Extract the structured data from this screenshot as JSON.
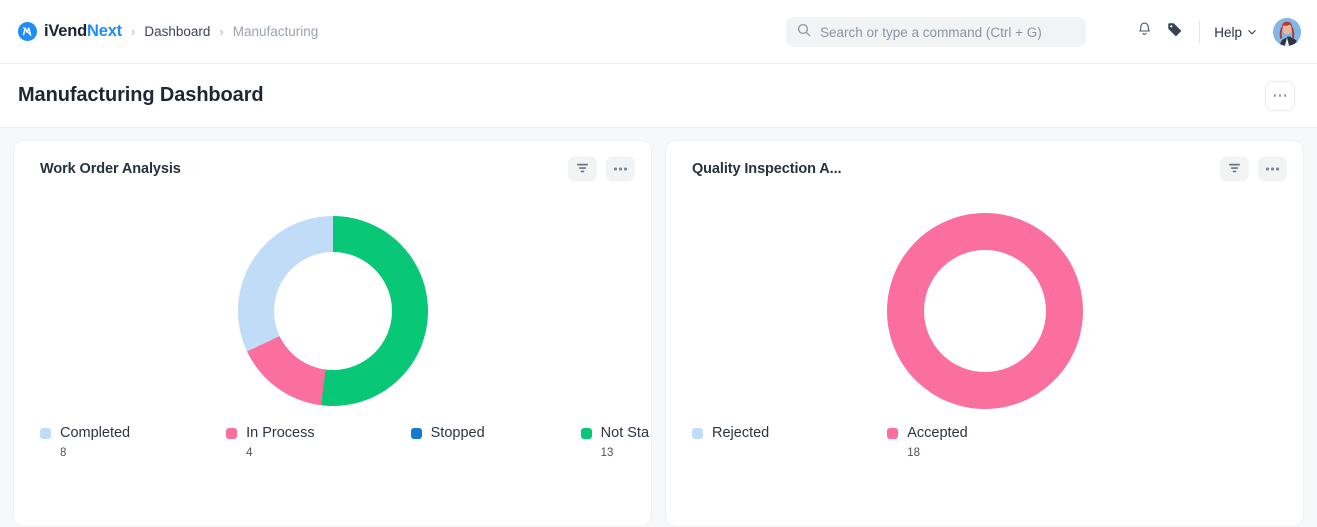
{
  "header": {
    "brand": {
      "part1": "iVend",
      "part2": "Next",
      "logo_icon": "ivendnext-logo-icon"
    },
    "breadcrumbs": [
      {
        "label": "Dashboard",
        "current": false
      },
      {
        "label": "Manufacturing",
        "current": true
      }
    ],
    "separator": "›",
    "search": {
      "placeholder": "Search or type a command (Ctrl + G)",
      "value": "",
      "icon": "search-icon"
    },
    "notifications_icon": "bell-icon",
    "tags_icon": "tag-icon",
    "help": {
      "label": "Help",
      "chevron": "chevron-down-icon"
    },
    "avatar_alt": "user-avatar"
  },
  "page": {
    "title": "Manufacturing Dashboard",
    "menu_icon": "ellipsis-icon"
  },
  "cards": [
    {
      "title": "Work Order Analysis",
      "filter_icon": "filter-icon",
      "menu_icon": "ellipsis-icon"
    },
    {
      "title": "Quality Inspection A...",
      "filter_icon": "filter-icon",
      "menu_icon": "ellipsis-icon"
    }
  ],
  "chart_data": [
    {
      "type": "pie",
      "variant": "donut",
      "title": "Work Order Analysis",
      "labels": [
        "Completed",
        "In Process",
        "Stopped",
        "Not Sta"
      ],
      "values": [
        8,
        4,
        0,
        13
      ],
      "value_labels": [
        "8",
        "4",
        "",
        "13"
      ],
      "colors": [
        "#c1dcf7",
        "#fb6f9e",
        "#1479d4",
        "#08c776"
      ],
      "total": 25,
      "legend_position": "bottom",
      "draw_order": [
        "Not Sta",
        "In Process",
        "Completed"
      ],
      "segments_deg": [
        {
          "label": "Not Sta",
          "start": 0,
          "end": 187.2,
          "color": "#08c776"
        },
        {
          "label": "In Process",
          "start": 187.2,
          "end": 244.8,
          "color": "#fb6f9e"
        },
        {
          "label": "Completed",
          "start": 244.8,
          "end": 360,
          "color": "#c1dcf7"
        }
      ]
    },
    {
      "type": "pie",
      "variant": "donut",
      "title": "Quality Inspection A...",
      "labels": [
        "Rejected",
        "Accepted"
      ],
      "values": [
        0,
        18
      ],
      "value_labels": [
        "",
        "18"
      ],
      "colors": [
        "#c1dcf7",
        "#fb6f9e"
      ],
      "total": 18,
      "legend_position": "bottom",
      "segments_deg": [
        {
          "label": "Accepted",
          "start": 0,
          "end": 360,
          "color": "#fb6f9e"
        }
      ]
    }
  ],
  "theme": {
    "brand_blue": "#1e8df6",
    "page_bg": "#f7f8f9",
    "card_bg": "#ffffff",
    "text_dark": "#1f2733",
    "text_muted": "#9aa2ad"
  }
}
